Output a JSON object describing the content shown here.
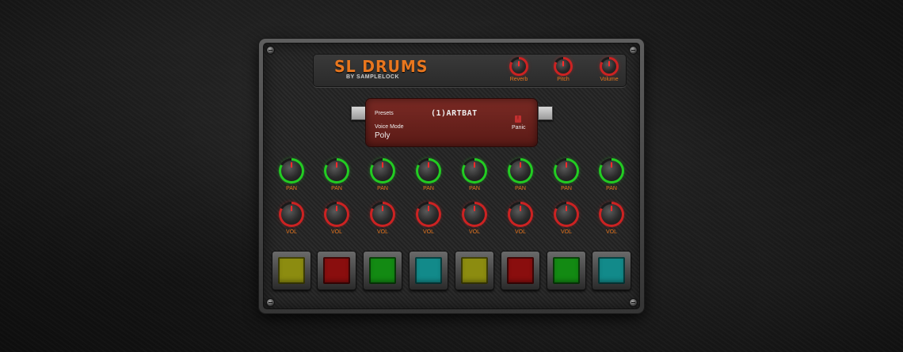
{
  "plugin": {
    "title": "SL DRUMS",
    "subtitle": "BY SAMPLELOCK",
    "accent_color": "#e8761e"
  },
  "master_knobs": [
    {
      "label": "Reverb",
      "ring_color": "#cc2222"
    },
    {
      "label": "Pitch",
      "ring_color": "#cc2222"
    },
    {
      "label": "Volume",
      "ring_color": "#cc2222"
    }
  ],
  "display": {
    "presets_label": "Presets",
    "preset_name": "(1)ARTBAT",
    "voice_mode_label": "Voice Mode",
    "voice_mode_value": "Poly",
    "panic_label": "Panic",
    "panic_indicator": "!",
    "prev_icon": "prev-preset-icon",
    "next_icon": "next-preset-icon"
  },
  "pan_knobs": [
    {
      "label": "PAN"
    },
    {
      "label": "PAN"
    },
    {
      "label": "PAN"
    },
    {
      "label": "PAN"
    },
    {
      "label": "PAN"
    },
    {
      "label": "PAN"
    },
    {
      "label": "PAN"
    },
    {
      "label": "PAN"
    }
  ],
  "vol_knobs": [
    {
      "label": "VOL"
    },
    {
      "label": "VOL"
    },
    {
      "label": "VOL"
    },
    {
      "label": "VOL"
    },
    {
      "label": "VOL"
    },
    {
      "label": "VOL"
    },
    {
      "label": "VOL"
    },
    {
      "label": "VOL"
    }
  ],
  "pads": [
    {
      "color": "#8c8c10"
    },
    {
      "color": "#8a0e0e"
    },
    {
      "color": "#138a13"
    },
    {
      "color": "#128a8a"
    },
    {
      "color": "#8c8c10"
    },
    {
      "color": "#8a0e0e"
    },
    {
      "color": "#138a13"
    },
    {
      "color": "#128a8a"
    }
  ],
  "ring_colors": {
    "pan": "#22cc22",
    "vol": "#cc2222"
  }
}
